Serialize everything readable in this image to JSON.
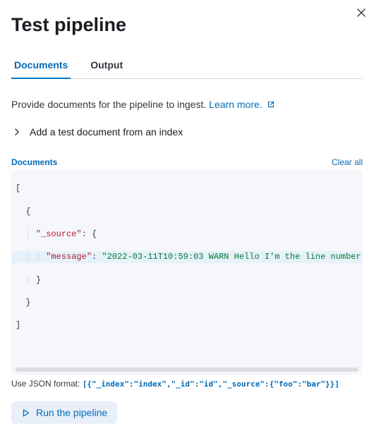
{
  "header": {
    "title": "Test pipeline"
  },
  "tabs": {
    "documents": "Documents",
    "output": "Output"
  },
  "description": {
    "text": "Provide documents for the pipeline to ingest. ",
    "learn_more": "Learn more."
  },
  "accordion": {
    "label": "Add a test document from an index"
  },
  "editor": {
    "label": "Documents",
    "clear_all": "Clear all",
    "code": {
      "line1": "[",
      "line2_open": "{",
      "source_key": "\"_source\"",
      "message_key": "\"message\"",
      "message_value": "\"2022-03-11T10:59:03 WARN Hello I'm the line number",
      "close_brace": "}",
      "line7": "]"
    }
  },
  "hint": {
    "prefix": "Use JSON format: ",
    "example": "[{\"_index\":\"index\",\"_id\":\"id\",\"_source\":{\"foo\":\"bar\"}}]"
  },
  "actions": {
    "run": "Run the pipeline"
  }
}
